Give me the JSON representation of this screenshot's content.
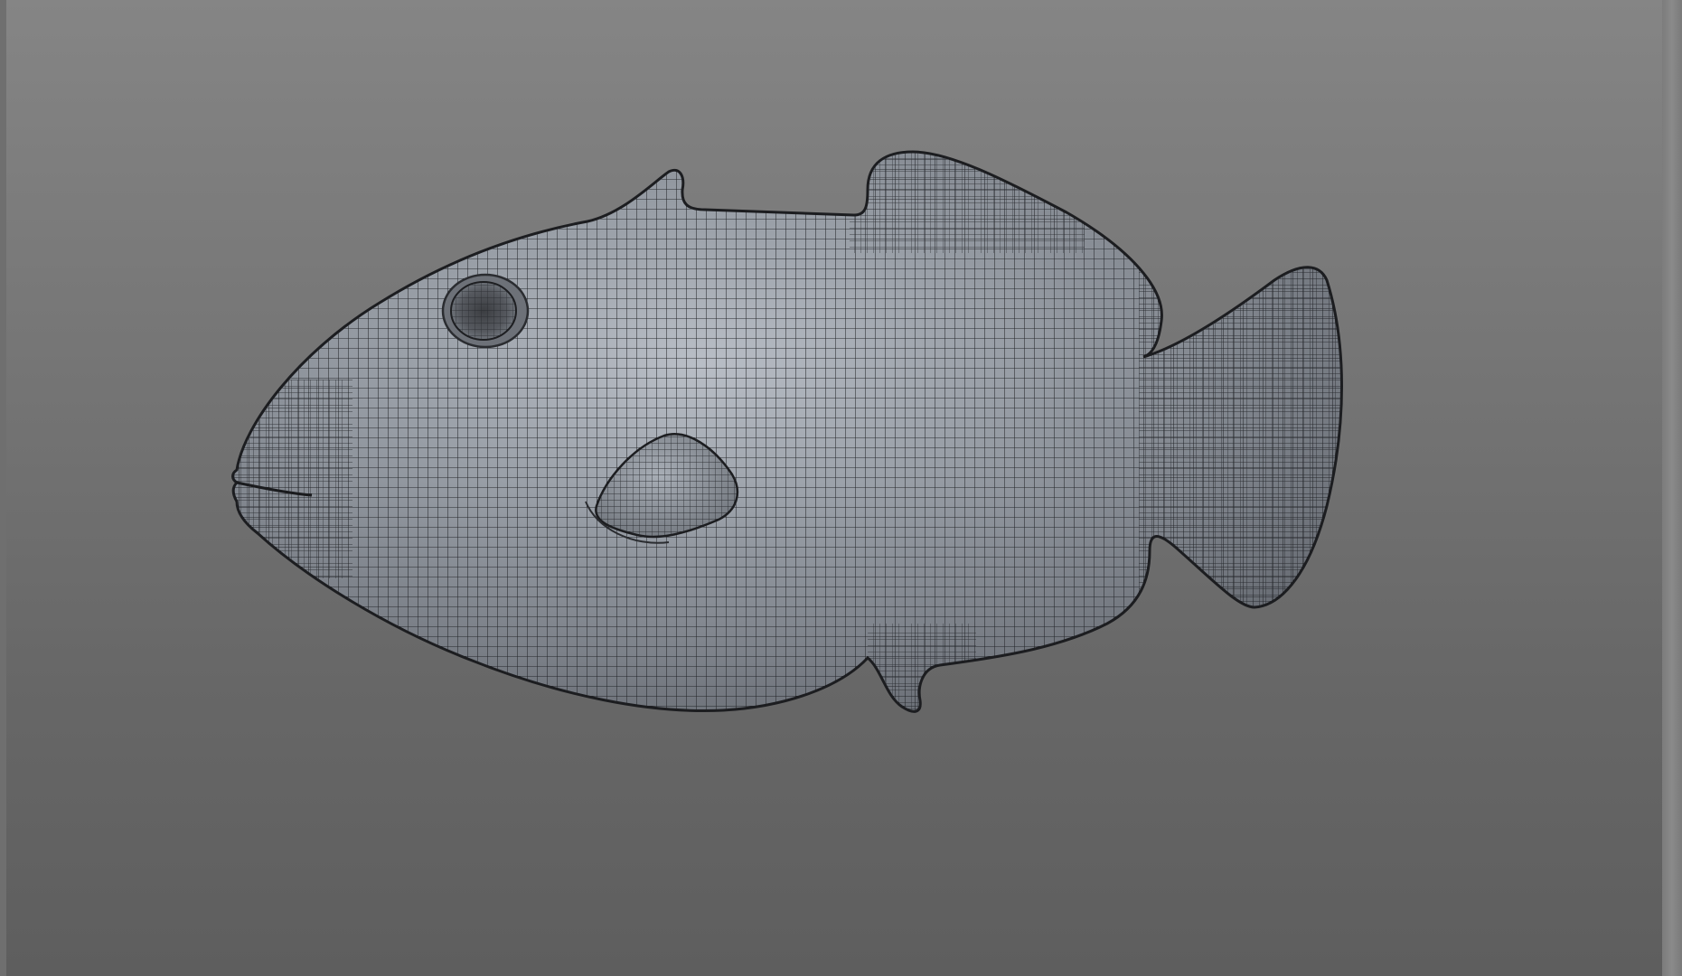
{
  "viewport": {
    "background_top": "#858585",
    "background_bottom": "#5e5e5e",
    "display_mode": "wireframe-on-shaded"
  },
  "model": {
    "subject": "fish",
    "surface_color": "#8b9199",
    "highlight_color": "#b4bac2",
    "wire_color": "#1e1f22"
  }
}
